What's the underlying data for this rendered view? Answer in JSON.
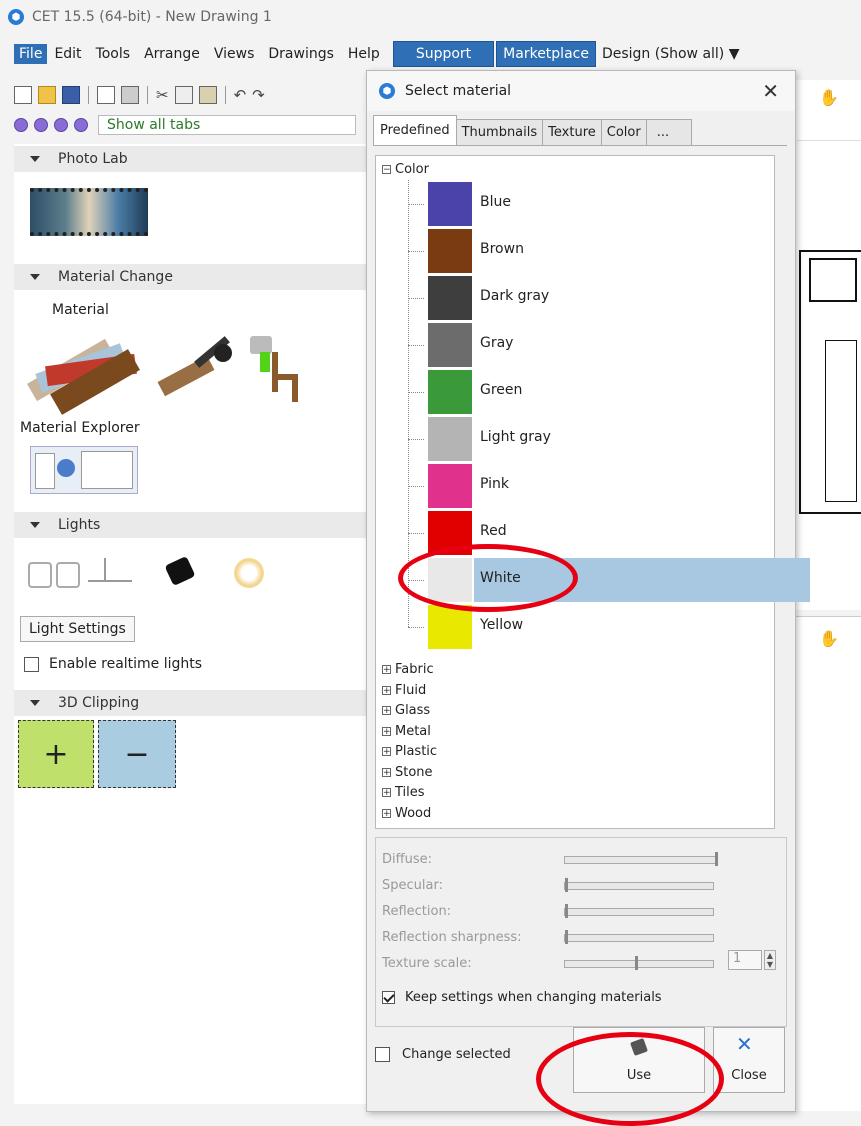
{
  "window": {
    "title": "CET 15.5 (64-bit) - New Drawing 1"
  },
  "menu": {
    "items": [
      "File",
      "Edit",
      "Tools",
      "Arrange",
      "Views",
      "Drawings",
      "Help"
    ],
    "support": "Support",
    "marketplace": "Marketplace",
    "design": "Design (Show all) ▼"
  },
  "tabsrow": {
    "show_all": "Show all tabs"
  },
  "left": {
    "photo_lab": "Photo Lab",
    "material_change": "Material Change",
    "material": "Material",
    "material_explorer": "Material Explorer",
    "lights": "Lights",
    "light_settings": "Light Settings",
    "enable_realtime": "Enable realtime lights",
    "clipping": "3D Clipping",
    "plus": "+",
    "minus": "−"
  },
  "dialog": {
    "title": "Select material",
    "close_glyph": "✕",
    "tabs": [
      "Predefined",
      "Thumbnails",
      "Texture",
      "Color",
      "..."
    ],
    "root": "Color",
    "colors": [
      {
        "name": "Blue",
        "color": "#4b44a8"
      },
      {
        "name": "Brown",
        "color": "#7a3b13"
      },
      {
        "name": "Dark gray",
        "color": "#3e3e3e"
      },
      {
        "name": "Gray",
        "color": "#6c6c6c"
      },
      {
        "name": "Green",
        "color": "#3a9a3a"
      },
      {
        "name": "Light gray",
        "color": "#b4b4b4"
      },
      {
        "name": "Pink",
        "color": "#e0328c"
      },
      {
        "name": "Red",
        "color": "#e00000"
      },
      {
        "name": "White",
        "color": "#e8e8e8"
      },
      {
        "name": "Yellow",
        "color": "#e8e800"
      }
    ],
    "selected": "White",
    "categories": [
      "Fabric",
      "Fluid",
      "Glass",
      "Metal",
      "Plastic",
      "Stone",
      "Tiles",
      "Wood"
    ],
    "settings": {
      "diffuse": "Diffuse:",
      "specular": "Specular:",
      "reflection": "Reflection:",
      "reflection_sharpness": "Reflection sharpness:",
      "texture_scale": "Texture scale:",
      "texture_scale_value": "1",
      "keep_settings": "Keep settings when changing materials"
    },
    "change_selected": "Change selected",
    "use": "Use",
    "close": "Close"
  },
  "colors": {
    "accent": "#2f6fb5",
    "selection": "#a7c8e0",
    "annotation": "#e60012",
    "clip_plus": "#bfe06a",
    "clip_minus": "#a9cce0"
  }
}
